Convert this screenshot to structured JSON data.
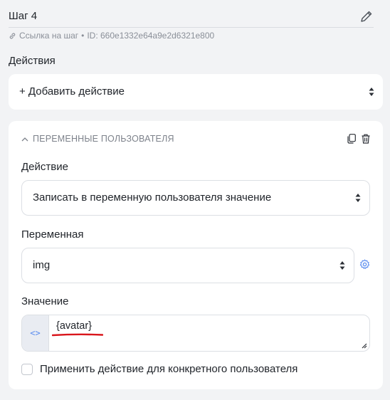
{
  "step": {
    "title": "Шаг 4",
    "link_label": "Ссылка на шаг",
    "separator": "•",
    "id_text": "ID: 660e1332e64a9e2d6321e800"
  },
  "actions_section": {
    "label": "Действия",
    "add_action_label": "+ Добавить действие"
  },
  "action_card": {
    "header": "ПЕРЕМЕННЫЕ ПОЛЬЗОВАТЕЛЯ",
    "action_label": "Действие",
    "action_value": "Записать в переменную пользователя значение",
    "variable_label": "Переменная",
    "variable_value": "img",
    "value_label": "Значение",
    "value_text": "{avatar}",
    "code_toggle_glyph": "<>",
    "checkbox_label": "Применить действие для конкретного пользователя",
    "checkbox_checked": false
  },
  "colors": {
    "background": "#f2f3f5",
    "card": "#ffffff",
    "accent": "#5b8def",
    "annotation_underline": "#d9161c",
    "muted_text": "#8a8f98"
  },
  "icons": [
    "edit-pencil-icon",
    "link-icon",
    "sort-arrows-icon",
    "chevron-up-icon",
    "copy-icon",
    "trash-icon",
    "gear-icon",
    "code-icon",
    "resize-handle-icon"
  ]
}
